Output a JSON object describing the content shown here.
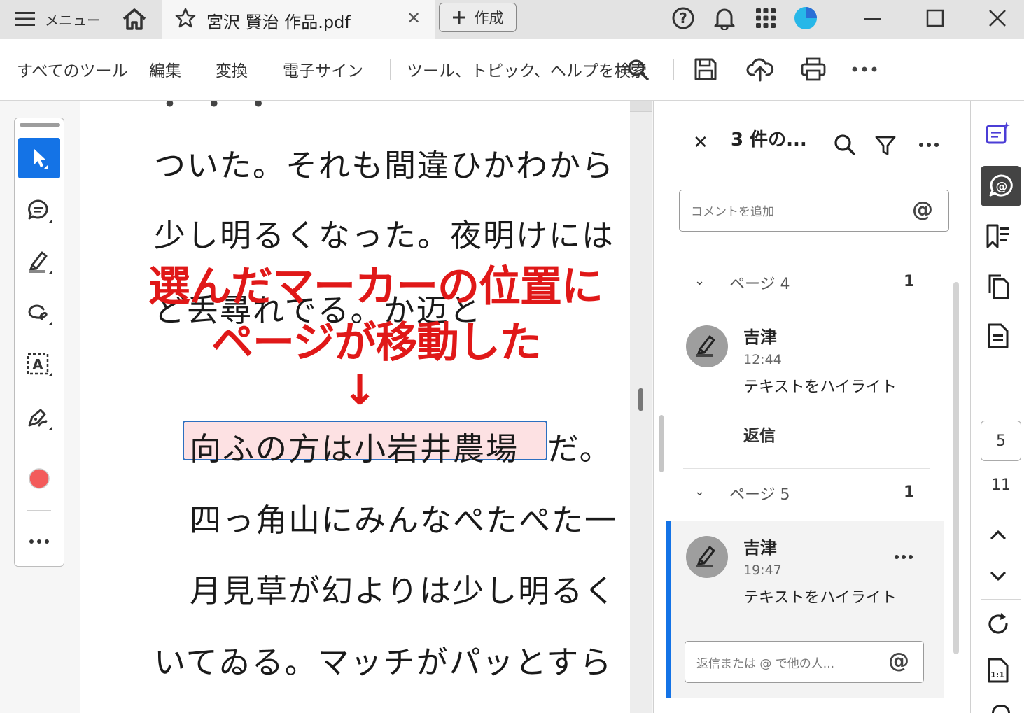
{
  "titlebar": {
    "menu_label": "メニュー",
    "tab_title": "宮沢 賢治 作品.pdf",
    "create_label": "作成"
  },
  "toolbar": {
    "all_tools": "すべてのツール",
    "edit": "編集",
    "convert": "変換",
    "esign": "電子サイン",
    "search_placeholder": "ツール、トピック、ヘルプを検索"
  },
  "document": {
    "lines": [
      "ついた。それも間違ひかわから",
      "少し明るくなった。夜明けには",
      "ど丢尋れでる。か迈と",
      "向ふの方は小岩井農場",
      "だ。",
      "四っ角山にみんなぺたぺた一",
      "月見草が幻よりは少し明るく",
      "いてゐる。マッチがパッとすら"
    ]
  },
  "annotation": {
    "line1": "選んだマーカーの位置に",
    "line2": "ページが移動した",
    "arrow": "↓"
  },
  "comments_panel": {
    "title": "3 件の...",
    "add_comment_placeholder": "コメントを追加",
    "groups": [
      {
        "page_label": "ページ 4",
        "count": "1",
        "comment": {
          "author": "吉津",
          "time": "12:44",
          "text": "テキストをハイライト",
          "reply": "返信"
        }
      },
      {
        "page_label": "ページ 5",
        "count": "1",
        "comment": {
          "author": "吉津",
          "time": "19:47",
          "text": "テキストをハイライト"
        }
      }
    ],
    "reply_placeholder": "返信または @ で他の人..."
  },
  "page_nav": {
    "current": "5",
    "total": "11"
  },
  "colors": {
    "accent": "#1473e6",
    "highlight": "#fde1e3",
    "annotation_red": "#e01818",
    "color_swatch": "#f35b5b"
  }
}
